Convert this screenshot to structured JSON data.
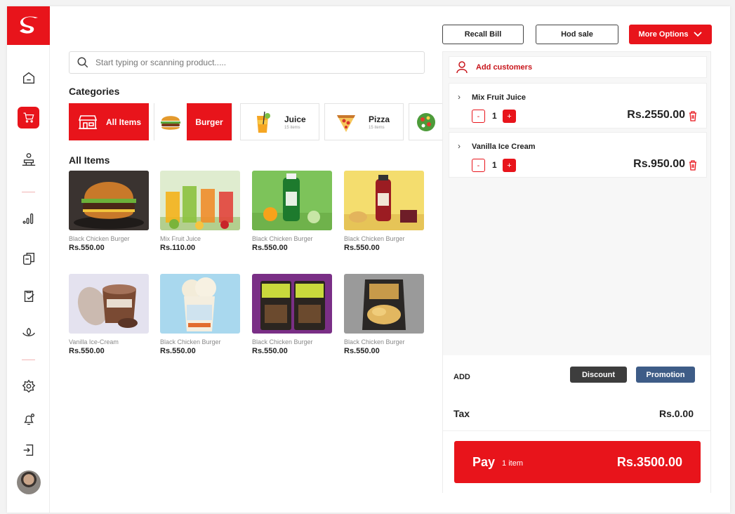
{
  "header": {
    "recall_bill": "Recall Bill",
    "hod_sale": "Hod sale",
    "more_options": "More Options"
  },
  "search": {
    "placeholder": "Start typing or scanning product....."
  },
  "categories": {
    "title": "Categories",
    "items": [
      {
        "label": "All Items",
        "icon": "store-icon"
      },
      {
        "label": "Burger",
        "icon": "burger-icon"
      },
      {
        "label": "Juice",
        "count": "15 items",
        "icon": "juice-icon"
      },
      {
        "label": "Pizza",
        "count": "15 items",
        "icon": "pizza-icon"
      },
      {
        "label": "",
        "icon": "salad-icon"
      }
    ]
  },
  "all_items": {
    "title": "All Items",
    "products": [
      {
        "name": "Black Chicken Burger",
        "price": "Rs.550.00",
        "image": "burger"
      },
      {
        "name": "Mix Fruit Juice",
        "price": "Rs.110.00",
        "image": "juices"
      },
      {
        "name": "Black Chicken Burger",
        "price": "Rs.550.00",
        "image": "green-bottle"
      },
      {
        "name": "Black Chicken Burger",
        "price": "Rs.550.00",
        "image": "red-bottle"
      },
      {
        "name": "Vanilla Ice-Cream",
        "price": "Rs.550.00",
        "image": "ice-cream-tub"
      },
      {
        "name": "Black Chicken Burger",
        "price": "Rs.550.00",
        "image": "ice-cream-cup"
      },
      {
        "name": "Black Chicken Burger",
        "price": "Rs.550.00",
        "image": "kick-nuts"
      },
      {
        "name": "Black Chicken Burger",
        "price": "Rs.550.00",
        "image": "kettle-chips"
      }
    ]
  },
  "cart": {
    "add_customers": "Add customers",
    "lines": [
      {
        "name": "Mix Fruit Juice",
        "qty": "1",
        "price": "Rs.2550.00"
      },
      {
        "name": "Vanilla Ice Cream",
        "qty": "1",
        "price": "Rs.950.00"
      }
    ],
    "minus": "-",
    "plus": "+",
    "add_label": "ADD",
    "discount": "Discount",
    "promotion": "Promotion",
    "tax_label": "Tax",
    "tax_value": "Rs.0.00",
    "pay_label": "Pay",
    "pay_count": "1 item",
    "pay_total": "Rs.3500.00"
  },
  "sidebar": {
    "items": [
      "home-icon",
      "cart-icon",
      "cashier-icon",
      "analytics-icon",
      "documents-icon",
      "clipboard-check-icon",
      "hand-leaf-icon",
      "settings-icon",
      "bell-icon",
      "logout-icon"
    ]
  },
  "colors": {
    "accent": "#e8141b",
    "discount": "#3d3d3d",
    "promotion": "#3e5c87"
  }
}
